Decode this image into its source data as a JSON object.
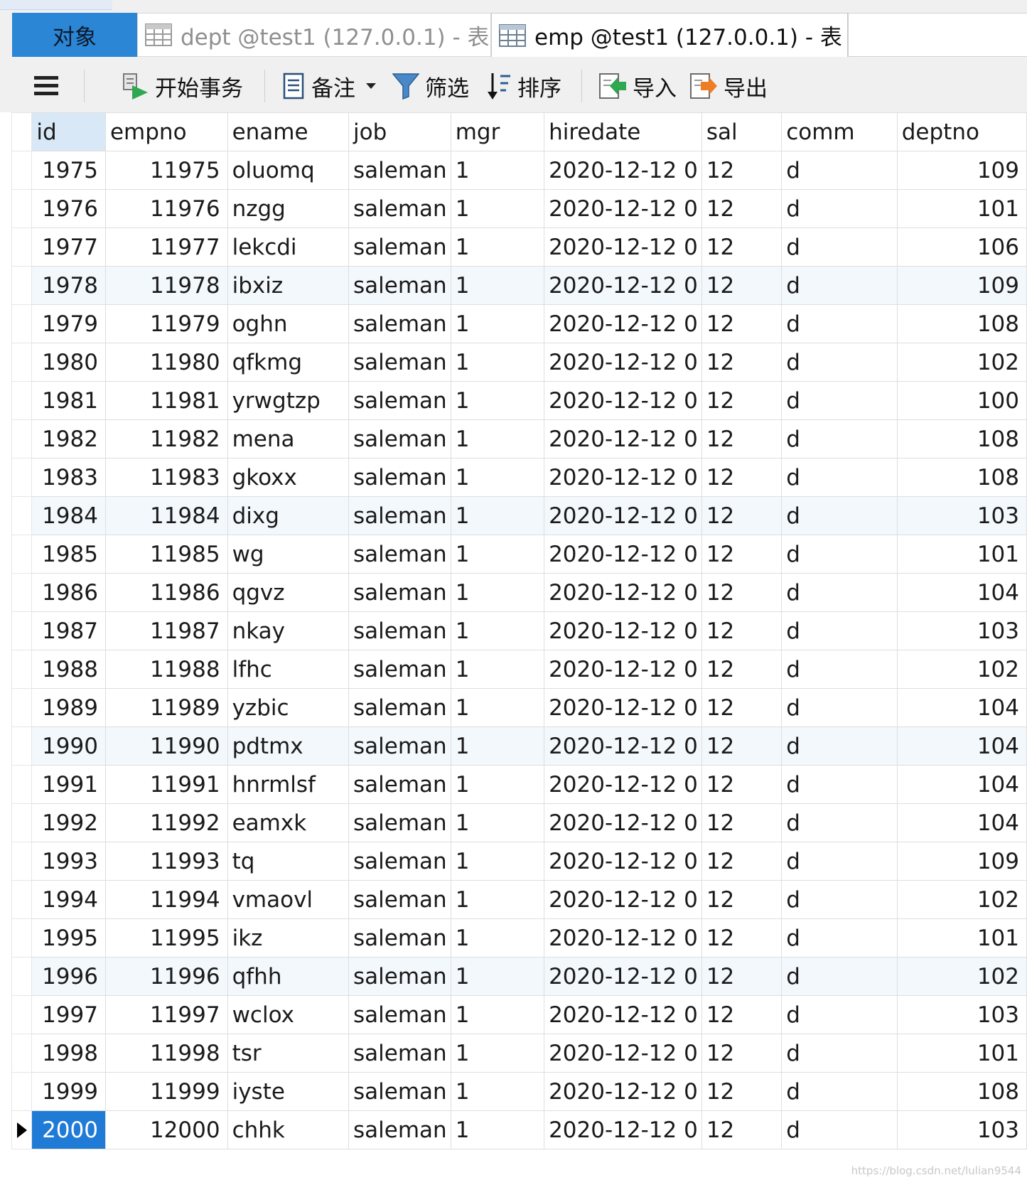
{
  "tabs": {
    "objects": "对象",
    "dept": "dept @test1 (127.0.0.1) - 表",
    "emp": "emp @test1 (127.0.0.1) - 表"
  },
  "toolbar": {
    "begin_transaction": "开始事务",
    "memo": "备注",
    "filter": "筛选",
    "sort": "排序",
    "import": "导入",
    "export": "导出"
  },
  "columns": [
    "id",
    "empno",
    "ename",
    "job",
    "mgr",
    "hiredate",
    "sal",
    "comm",
    "deptno"
  ],
  "rows": [
    {
      "id": "1975",
      "empno": "11975",
      "ename": "oluomq",
      "job": "saleman",
      "mgr": "1",
      "hiredate": "2020-12-12 0",
      "sal": "12",
      "comm": "d",
      "deptno": "109"
    },
    {
      "id": "1976",
      "empno": "11976",
      "ename": "nzgg",
      "job": "saleman",
      "mgr": "1",
      "hiredate": "2020-12-12 0",
      "sal": "12",
      "comm": "d",
      "deptno": "101"
    },
    {
      "id": "1977",
      "empno": "11977",
      "ename": "lekcdi",
      "job": "saleman",
      "mgr": "1",
      "hiredate": "2020-12-12 0",
      "sal": "12",
      "comm": "d",
      "deptno": "106"
    },
    {
      "id": "1978",
      "empno": "11978",
      "ename": "ibxiz",
      "job": "saleman",
      "mgr": "1",
      "hiredate": "2020-12-12 0",
      "sal": "12",
      "comm": "d",
      "deptno": "109"
    },
    {
      "id": "1979",
      "empno": "11979",
      "ename": "oghn",
      "job": "saleman",
      "mgr": "1",
      "hiredate": "2020-12-12 0",
      "sal": "12",
      "comm": "d",
      "deptno": "108"
    },
    {
      "id": "1980",
      "empno": "11980",
      "ename": "qfkmg",
      "job": "saleman",
      "mgr": "1",
      "hiredate": "2020-12-12 0",
      "sal": "12",
      "comm": "d",
      "deptno": "102"
    },
    {
      "id": "1981",
      "empno": "11981",
      "ename": "yrwgtzp",
      "job": "saleman",
      "mgr": "1",
      "hiredate": "2020-12-12 0",
      "sal": "12",
      "comm": "d",
      "deptno": "100"
    },
    {
      "id": "1982",
      "empno": "11982",
      "ename": "mena",
      "job": "saleman",
      "mgr": "1",
      "hiredate": "2020-12-12 0",
      "sal": "12",
      "comm": "d",
      "deptno": "108"
    },
    {
      "id": "1983",
      "empno": "11983",
      "ename": "gkoxx",
      "job": "saleman",
      "mgr": "1",
      "hiredate": "2020-12-12 0",
      "sal": "12",
      "comm": "d",
      "deptno": "108"
    },
    {
      "id": "1984",
      "empno": "11984",
      "ename": "dixg",
      "job": "saleman",
      "mgr": "1",
      "hiredate": "2020-12-12 0",
      "sal": "12",
      "comm": "d",
      "deptno": "103"
    },
    {
      "id": "1985",
      "empno": "11985",
      "ename": "wg",
      "job": "saleman",
      "mgr": "1",
      "hiredate": "2020-12-12 0",
      "sal": "12",
      "comm": "d",
      "deptno": "101"
    },
    {
      "id": "1986",
      "empno": "11986",
      "ename": "qgvz",
      "job": "saleman",
      "mgr": "1",
      "hiredate": "2020-12-12 0",
      "sal": "12",
      "comm": "d",
      "deptno": "104"
    },
    {
      "id": "1987",
      "empno": "11987",
      "ename": "nkay",
      "job": "saleman",
      "mgr": "1",
      "hiredate": "2020-12-12 0",
      "sal": "12",
      "comm": "d",
      "deptno": "103"
    },
    {
      "id": "1988",
      "empno": "11988",
      "ename": "lfhc",
      "job": "saleman",
      "mgr": "1",
      "hiredate": "2020-12-12 0",
      "sal": "12",
      "comm": "d",
      "deptno": "102"
    },
    {
      "id": "1989",
      "empno": "11989",
      "ename": "yzbic",
      "job": "saleman",
      "mgr": "1",
      "hiredate": "2020-12-12 0",
      "sal": "12",
      "comm": "d",
      "deptno": "104"
    },
    {
      "id": "1990",
      "empno": "11990",
      "ename": "pdtmx",
      "job": "saleman",
      "mgr": "1",
      "hiredate": "2020-12-12 0",
      "sal": "12",
      "comm": "d",
      "deptno": "104"
    },
    {
      "id": "1991",
      "empno": "11991",
      "ename": "hnrmlsf",
      "job": "saleman",
      "mgr": "1",
      "hiredate": "2020-12-12 0",
      "sal": "12",
      "comm": "d",
      "deptno": "104"
    },
    {
      "id": "1992",
      "empno": "11992",
      "ename": "eamxk",
      "job": "saleman",
      "mgr": "1",
      "hiredate": "2020-12-12 0",
      "sal": "12",
      "comm": "d",
      "deptno": "104"
    },
    {
      "id": "1993",
      "empno": "11993",
      "ename": "tq",
      "job": "saleman",
      "mgr": "1",
      "hiredate": "2020-12-12 0",
      "sal": "12",
      "comm": "d",
      "deptno": "109"
    },
    {
      "id": "1994",
      "empno": "11994",
      "ename": "vmaovl",
      "job": "saleman",
      "mgr": "1",
      "hiredate": "2020-12-12 0",
      "sal": "12",
      "comm": "d",
      "deptno": "102"
    },
    {
      "id": "1995",
      "empno": "11995",
      "ename": "ikz",
      "job": "saleman",
      "mgr": "1",
      "hiredate": "2020-12-12 0",
      "sal": "12",
      "comm": "d",
      "deptno": "101"
    },
    {
      "id": "1996",
      "empno": "11996",
      "ename": "qfhh",
      "job": "saleman",
      "mgr": "1",
      "hiredate": "2020-12-12 0",
      "sal": "12",
      "comm": "d",
      "deptno": "102"
    },
    {
      "id": "1997",
      "empno": "11997",
      "ename": "wclox",
      "job": "saleman",
      "mgr": "1",
      "hiredate": "2020-12-12 0",
      "sal": "12",
      "comm": "d",
      "deptno": "103"
    },
    {
      "id": "1998",
      "empno": "11998",
      "ename": "tsr",
      "job": "saleman",
      "mgr": "1",
      "hiredate": "2020-12-12 0",
      "sal": "12",
      "comm": "d",
      "deptno": "101"
    },
    {
      "id": "1999",
      "empno": "11999",
      "ename": "iyste",
      "job": "saleman",
      "mgr": "1",
      "hiredate": "2020-12-12 0",
      "sal": "12",
      "comm": "d",
      "deptno": "108"
    },
    {
      "id": "2000",
      "empno": "12000",
      "ename": "chhk",
      "job": "saleman",
      "mgr": "1",
      "hiredate": "2020-12-12 0",
      "sal": "12",
      "comm": "d",
      "deptno": "103"
    }
  ],
  "watermark": "https://blog.csdn.net/lulian9544",
  "colors": {
    "accent": "#2b86d6",
    "selected": "#1f7bd6",
    "header_id": "#d9e8f7",
    "stripe": "#f3f8fd"
  }
}
